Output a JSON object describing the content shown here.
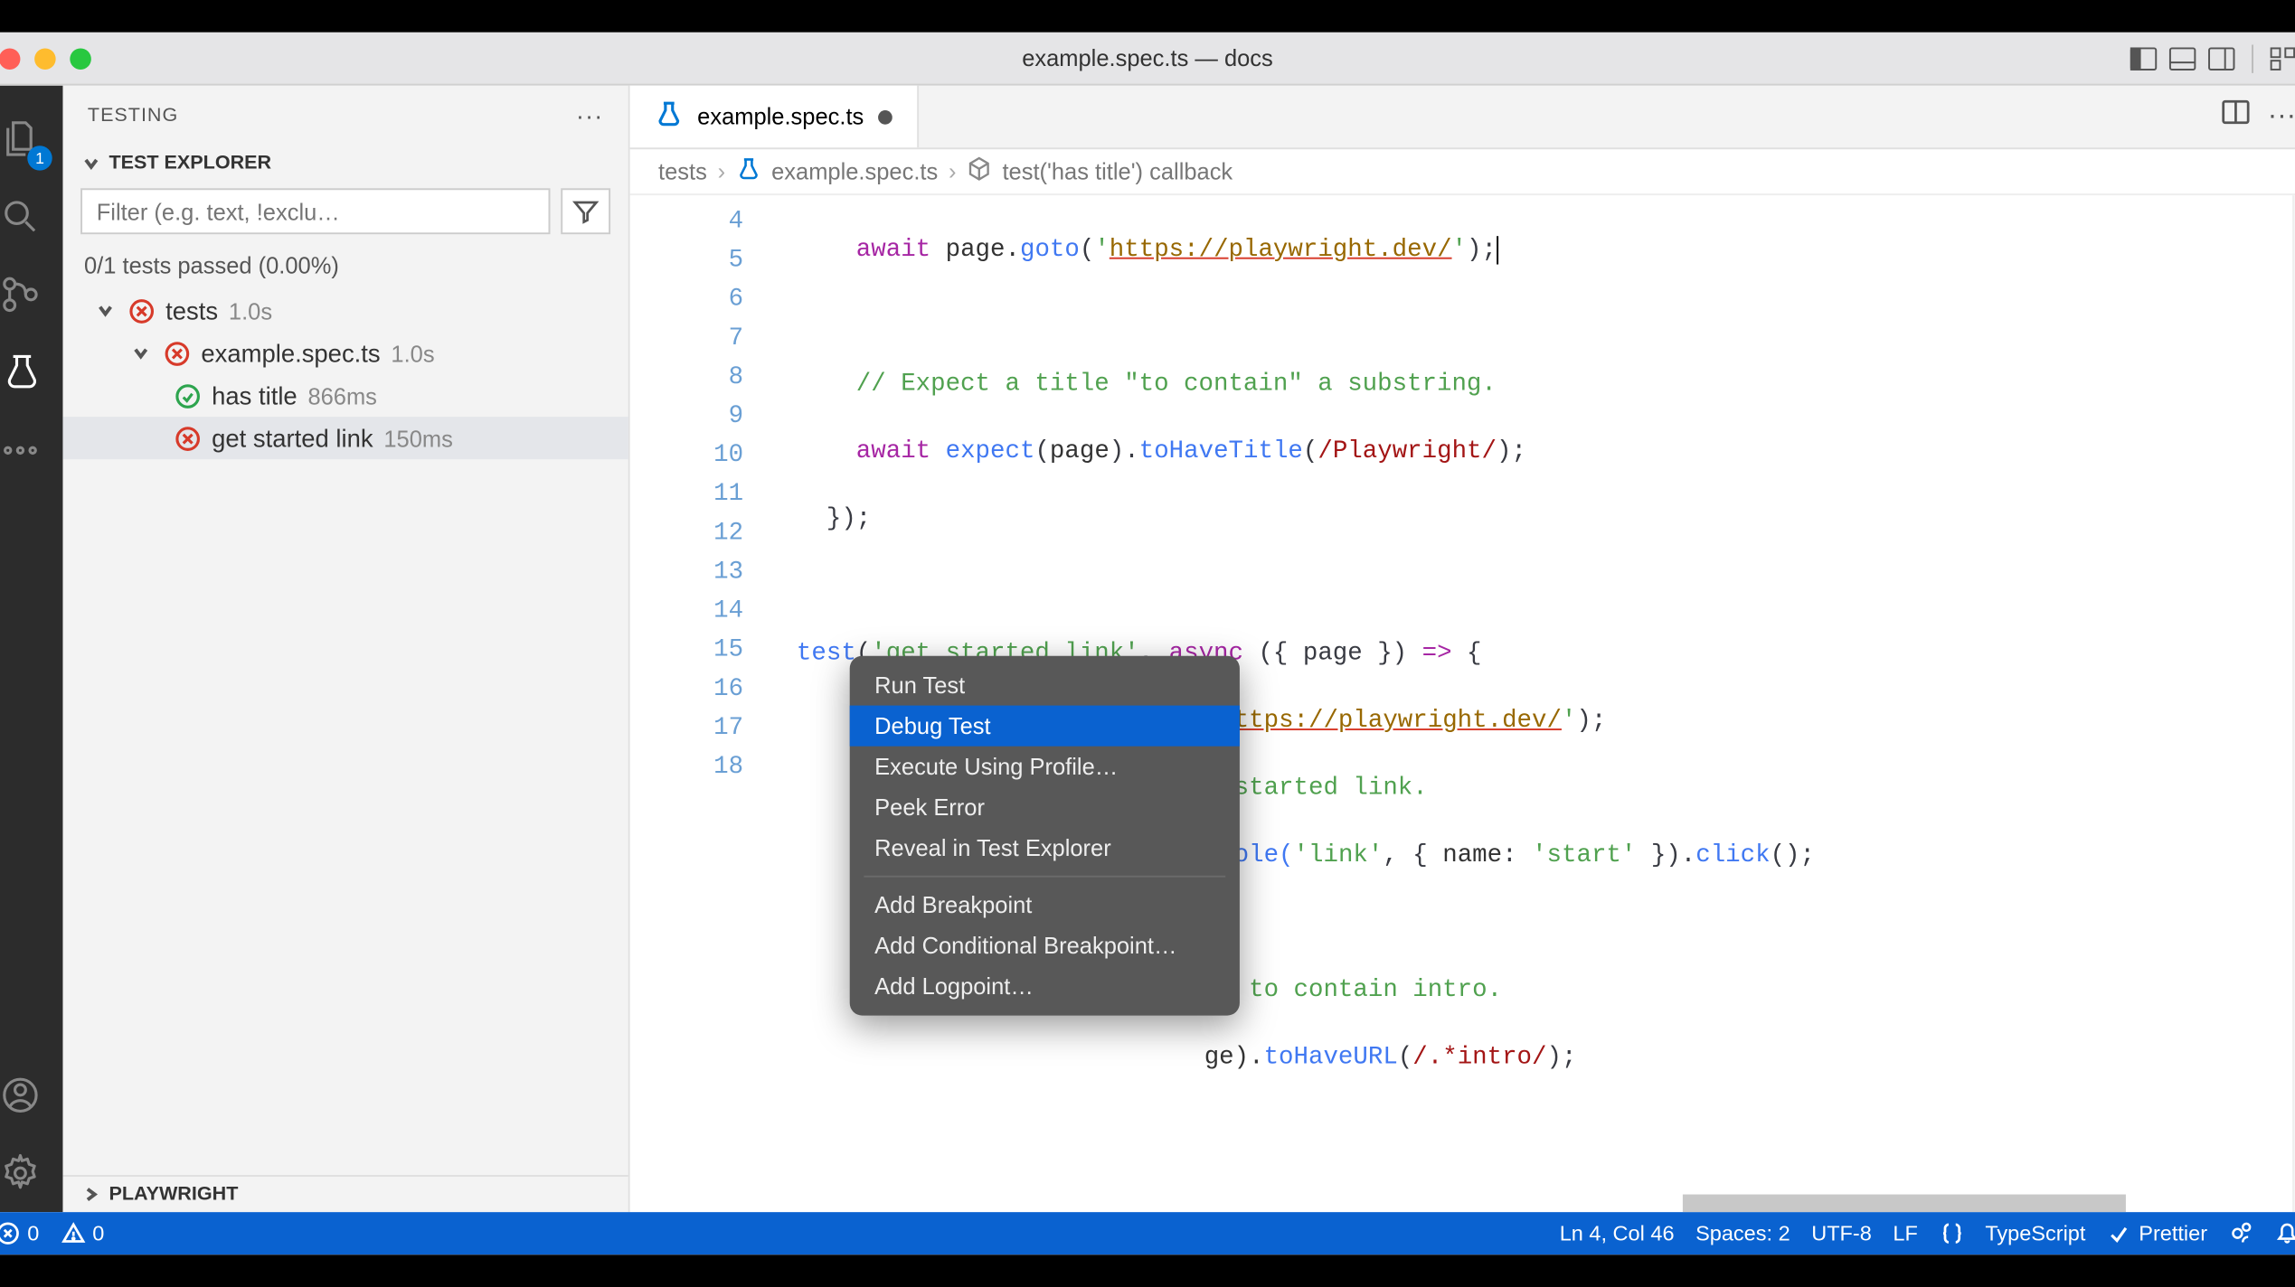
{
  "window": {
    "title": "example.spec.ts — docs"
  },
  "activity": {
    "explorer_badge": "1"
  },
  "sidebar": {
    "title": "TESTING",
    "section": "TEST EXPLORER",
    "filter_placeholder": "Filter (e.g. text, !exclu…",
    "summary": "0/1 tests passed (0.00%)",
    "tree": {
      "root": {
        "label": "tests",
        "time": "1.0s"
      },
      "file": {
        "label": "example.spec.ts",
        "time": "1.0s"
      },
      "t1": {
        "label": "has title",
        "time": "866ms"
      },
      "t2": {
        "label": "get started link",
        "time": "150ms"
      }
    },
    "bottom_section": "PLAYWRIGHT"
  },
  "tab": {
    "label": "example.spec.ts"
  },
  "breadcrumbs": {
    "p0": "tests",
    "p1": "example.spec.ts",
    "p2": "test('has title') callback"
  },
  "code": {
    "lines": {
      "4": {
        "pre": "    ",
        "kw": "await",
        "sp": " ",
        "obj": "page.",
        "fn": "goto",
        "op": "(",
        "q1": "'",
        "url": "https://playwright.dev/",
        "q2": "'",
        "cl": ");"
      },
      "5": "",
      "6": {
        "pre": "    ",
        "cmt": "// Expect a title \"to contain\" a substring."
      },
      "7": {
        "pre": "    ",
        "kw": "await",
        "sp": " ",
        "fn1": "expect",
        "op1": "(",
        "arg": "page",
        "op2": ").",
        "fn2": "toHaveTitle",
        "op3": "(",
        "re": "/Playwright/",
        "cl": ");"
      },
      "8": {
        "pre": "  ",
        "txt": "});"
      },
      "9": "",
      "10": {
        "fn": "test",
        "op": "(",
        "str": "'get started link'",
        "c": ", ",
        "kw": "async",
        "sp": " ",
        "args": "({ page }) ",
        "ar": "=> ",
        "br": "{"
      },
      "11": {
        "tail_q": "'",
        "tail_url": "https://playwright.dev/",
        "tail_q2": "'",
        "tail_cl": ");"
      },
      "11b": "t started link.",
      "12": "",
      "13": {
        "tail": "yRole(",
        "str": "'link'",
        "c": ", { ",
        "key": "name",
        "c2": ": ",
        "str2": "'start'",
        "c3": " }).",
        "fn": "click",
        "cl": "();"
      },
      "14": "",
      "15": {
        "tail": "RL to contain intro."
      },
      "16": {
        "tail": "ge).",
        "fn": "toHaveURL",
        "op": "(",
        "re": "/.*intro/",
        "cl": ");"
      },
      "17": "",
      "18": ""
    },
    "line_numbers": [
      "4",
      "5",
      "6",
      "7",
      "8",
      "9",
      "10",
      "11",
      "12",
      "13",
      "14",
      "15",
      "16",
      "17",
      "18"
    ]
  },
  "context_menu": {
    "items": [
      "Run Test",
      "Debug Test",
      "Execute Using Profile…",
      "Peek Error",
      "Reveal in Test Explorer",
      "Add Breakpoint",
      "Add Conditional Breakpoint…",
      "Add Logpoint…"
    ],
    "highlighted_index": 1,
    "separator_after": [
      4
    ]
  },
  "statusbar": {
    "errors": "0",
    "warnings": "0",
    "cursor": "Ln 4, Col 46",
    "indent": "Spaces: 2",
    "encoding": "UTF-8",
    "eol": "LF",
    "lang": "TypeScript",
    "prettier": "Prettier"
  }
}
